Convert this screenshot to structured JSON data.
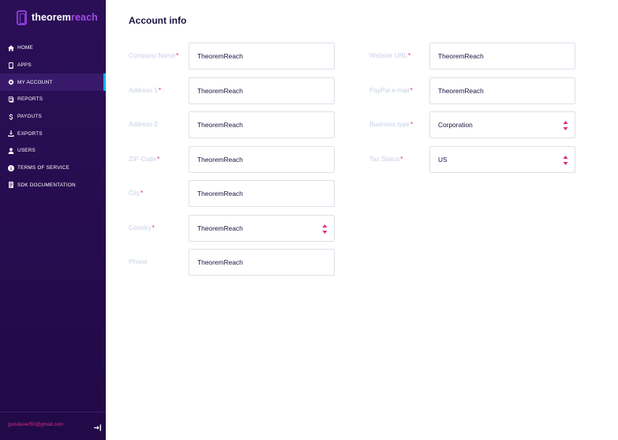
{
  "app": {
    "logo_part1": "theorem",
    "logo_part2": "reach"
  },
  "sidebar": {
    "items": [
      {
        "label": "HOME",
        "icon": "home-icon"
      },
      {
        "label": "APPS",
        "icon": "phone-icon"
      },
      {
        "label": "MY ACCOUNT",
        "icon": "gear-icon",
        "active": true
      },
      {
        "label": "REPORTS",
        "icon": "reports-icon"
      },
      {
        "label": "PAYOUTS",
        "icon": "dollar-icon"
      },
      {
        "label": "EXPORTS",
        "icon": "download-icon"
      },
      {
        "label": "USERS",
        "icon": "user-icon"
      },
      {
        "label": "TERMS OF SERVICE",
        "icon": "info-icon"
      },
      {
        "label": "SDK DOCUMENTATION",
        "icon": "document-icon"
      }
    ],
    "user_email": "gulsdever50@gmail.com"
  },
  "page": {
    "title": "Account info"
  },
  "form": {
    "left": [
      {
        "label": "Company Name",
        "required": "*",
        "value": "TheoremReach"
      },
      {
        "label": "Address 1",
        "required": "*",
        "value": "TheoremReach"
      },
      {
        "label": "Address 2",
        "required": "",
        "value": "TheoremReach"
      },
      {
        "label": "ZIP-Code",
        "required": "*",
        "value": "TheoremReach"
      },
      {
        "label": "City",
        "required": "*",
        "value": "TheoremReach"
      },
      {
        "label": "Country",
        "required": "*",
        "value": "TheoremReach"
      },
      {
        "label": "Phone",
        "required": "",
        "value": "TheoremReach"
      }
    ],
    "right": [
      {
        "label": "Website URL",
        "required": "*",
        "value": "TheoremReach"
      },
      {
        "label": "PayPal e-mail",
        "required": "*",
        "value": "TheoremReach"
      },
      {
        "label": "Business type",
        "required": "*",
        "value": "Corporation"
      },
      {
        "label": "Tax Status",
        "required": "*",
        "value": "US"
      }
    ]
  },
  "colors": {
    "sidebar_bg": "#250c4e",
    "accent_pink": "#e0297f",
    "accent_purple": "#a24ce5",
    "active_indicator": "#12b3e3"
  }
}
